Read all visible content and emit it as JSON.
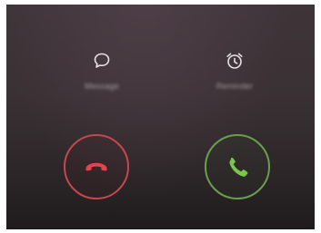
{
  "shortcuts": {
    "message": {
      "label": "Message",
      "icon": "message-bubble-icon",
      "color": "#e6e1e3"
    },
    "reminder": {
      "label": "Reminder",
      "icon": "alarm-clock-icon",
      "color": "#e6e1e3"
    }
  },
  "actions": {
    "decline": {
      "icon": "phone-hang-up-icon",
      "color": "#e8434d"
    },
    "answer": {
      "icon": "phone-answer-icon",
      "color": "#79c64a"
    }
  }
}
